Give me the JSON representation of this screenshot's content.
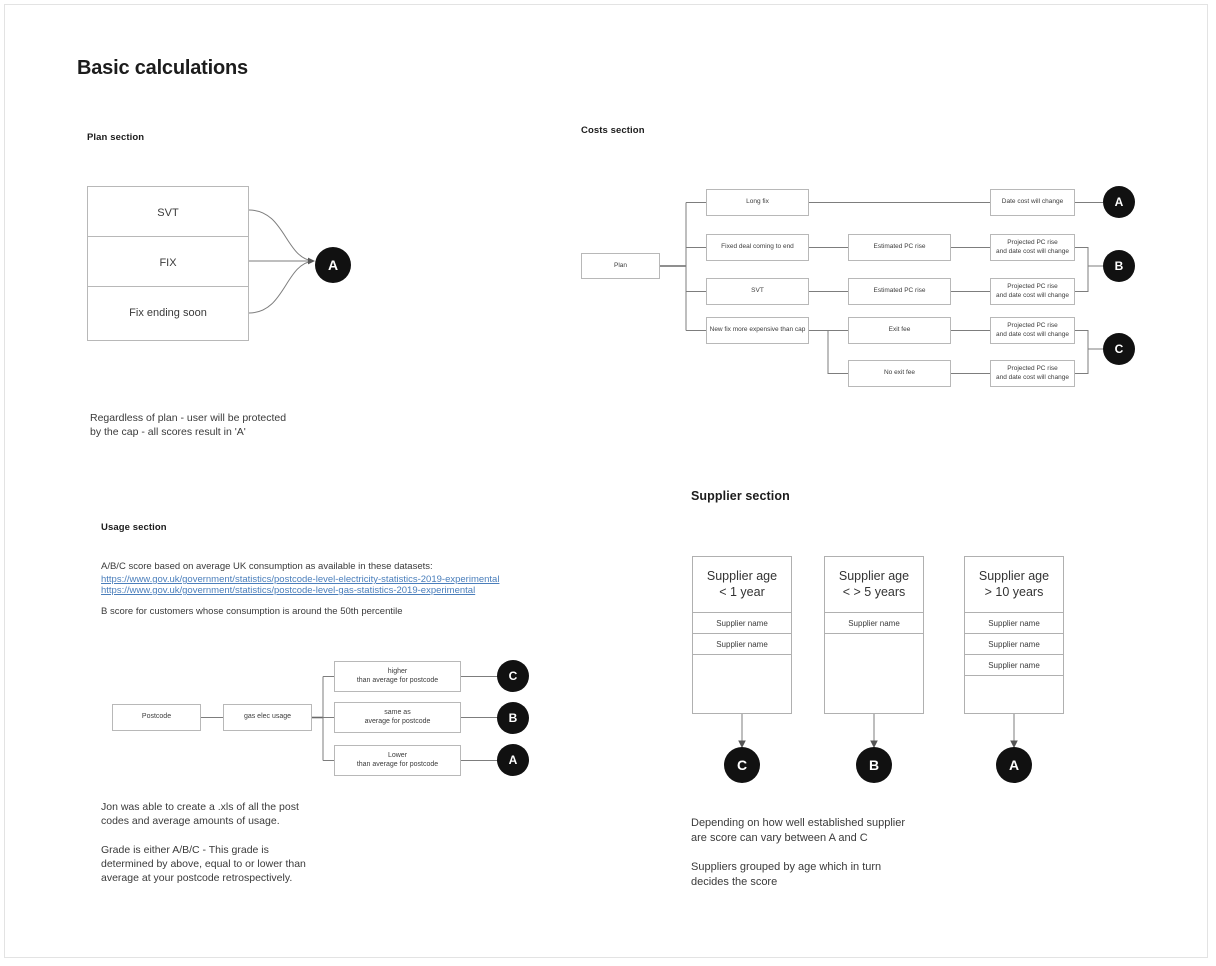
{
  "page": {
    "title": "Basic calculations"
  },
  "plan_section": {
    "title": "Plan section",
    "boxes": [
      {
        "label": "SVT"
      },
      {
        "label": "FIX"
      },
      {
        "label": "Fix ending soon"
      }
    ],
    "score": "A",
    "note": "Regardless of plan - user will be protected\nby the cap - all scores result in 'A'"
  },
  "costs_section": {
    "title": "Costs section",
    "root": "Plan",
    "level1": [
      {
        "label": "Long fix"
      },
      {
        "label": "Fixed deal coming to end"
      },
      {
        "label": "SVT"
      },
      {
        "label": "New fix more expensive than cap"
      }
    ],
    "level2": [
      {
        "label": "Estimated PC rise"
      },
      {
        "label": "Estimated PC rise"
      },
      {
        "label": "Exit fee"
      },
      {
        "label": "No exit fee"
      }
    ],
    "level3": [
      {
        "label": "Date cost will change"
      },
      {
        "label": "Projected PC rise\nand date cost will change"
      },
      {
        "label": "Projected PC rise\nand date cost will change"
      },
      {
        "label": "Projected PC rise\nand date cost will change"
      },
      {
        "label": "Projected PC rise\nand date cost will change"
      }
    ],
    "scores": [
      {
        "label": "A"
      },
      {
        "label": "B"
      },
      {
        "label": "C"
      }
    ]
  },
  "usage_section": {
    "title": "Usage section",
    "intro": "A/B/C score based on average UK consumption as available in these datasets:",
    "links": [
      "https://www.gov.uk/government/statistics/postcode-level-electricity-statistics-2019-experimental",
      "https://www.gov.uk/government/statistics/postcode-level-gas-statistics-2019-experimental"
    ],
    "subnote": "B score for customers whose consumption is around the 50th percentile",
    "flow": {
      "start": "Postcode",
      "middle": "gas elec usage",
      "outcomes": [
        {
          "label": "higher\nthan average for postcode",
          "score": "C"
        },
        {
          "label": "same as\naverage for postcode",
          "score": "B"
        },
        {
          "label": "Lower\nthan average for postcode",
          "score": "A"
        }
      ]
    },
    "note1": "Jon was able to create a .xls of all the post\ncodes and average amounts of usage.",
    "note2": "Grade is either A/B/C - This grade is\ndetermined by above, equal to or lower than\naverage at your postcode retrospectively."
  },
  "supplier_section": {
    "title": "Supplier section",
    "cards": [
      {
        "heading": "Supplier age\n< 1 year",
        "rows": [
          "Supplier name",
          "Supplier name"
        ],
        "score": "C"
      },
      {
        "heading": "Supplier age\n< > 5 years",
        "rows": [
          "Supplier name"
        ],
        "score": "B"
      },
      {
        "heading": "Supplier age\n> 10 years",
        "rows": [
          "Supplier name",
          "Supplier name",
          "Supplier name"
        ],
        "score": "A"
      }
    ],
    "note1": "Depending on how well established supplier\nare score can vary between A and C",
    "note2": "Suppliers grouped by age which in turn\ndecides the score"
  },
  "colors": {
    "score_badge": "#111111",
    "box_border": "#b8b8b8",
    "connector": "#7d7d7d",
    "link": "#4a7ebb"
  }
}
